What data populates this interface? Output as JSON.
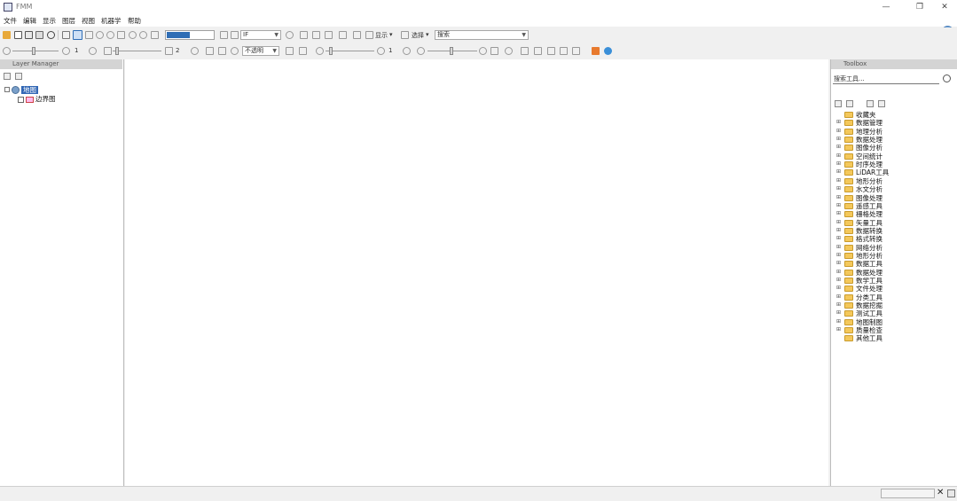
{
  "window": {
    "title": "FMM",
    "minimize": "—",
    "maximize": "❐",
    "close": "✕"
  },
  "menu": [
    "文件",
    "编辑",
    "显示",
    "图层",
    "视图",
    "机器学",
    "帮助"
  ],
  "toolbar1": {
    "display_dropdown": "显示",
    "select_dropdown": "选择",
    "search_combo": "搜索",
    "layer_combo": "IF"
  },
  "toolbar2": {
    "value1": "1",
    "value2": "2",
    "combo_label": "不透明",
    "value3": "1"
  },
  "layers_panel": {
    "header": "Layer Manager",
    "tree": [
      {
        "label": "地图",
        "selected": true
      },
      {
        "label": "边界图",
        "selected": false
      }
    ]
  },
  "toolbox": {
    "header": "Toolbox",
    "search_value": "搜索工具...",
    "categories": [
      "收藏夹",
      "数据管理",
      "地理分析",
      "数据处理",
      "图像分析",
      "空间统计",
      "时序处理",
      "LiDAR工具",
      "地形分析",
      "水文分析",
      "图像处理",
      "遥感工具",
      "栅格处理",
      "矢量工具",
      "数据转换",
      "格式转换",
      "网络分析",
      "地形分析",
      "数据工具",
      "数据处理",
      "数学工具",
      "文件处理",
      "分类工具",
      "数据挖掘",
      "测试工具",
      "地图制图",
      "质量检查",
      "其他工具"
    ]
  },
  "colors": {
    "selection": "#3267b5",
    "folder": "#f4c85b",
    "panel_header": "#d4d4d4"
  }
}
